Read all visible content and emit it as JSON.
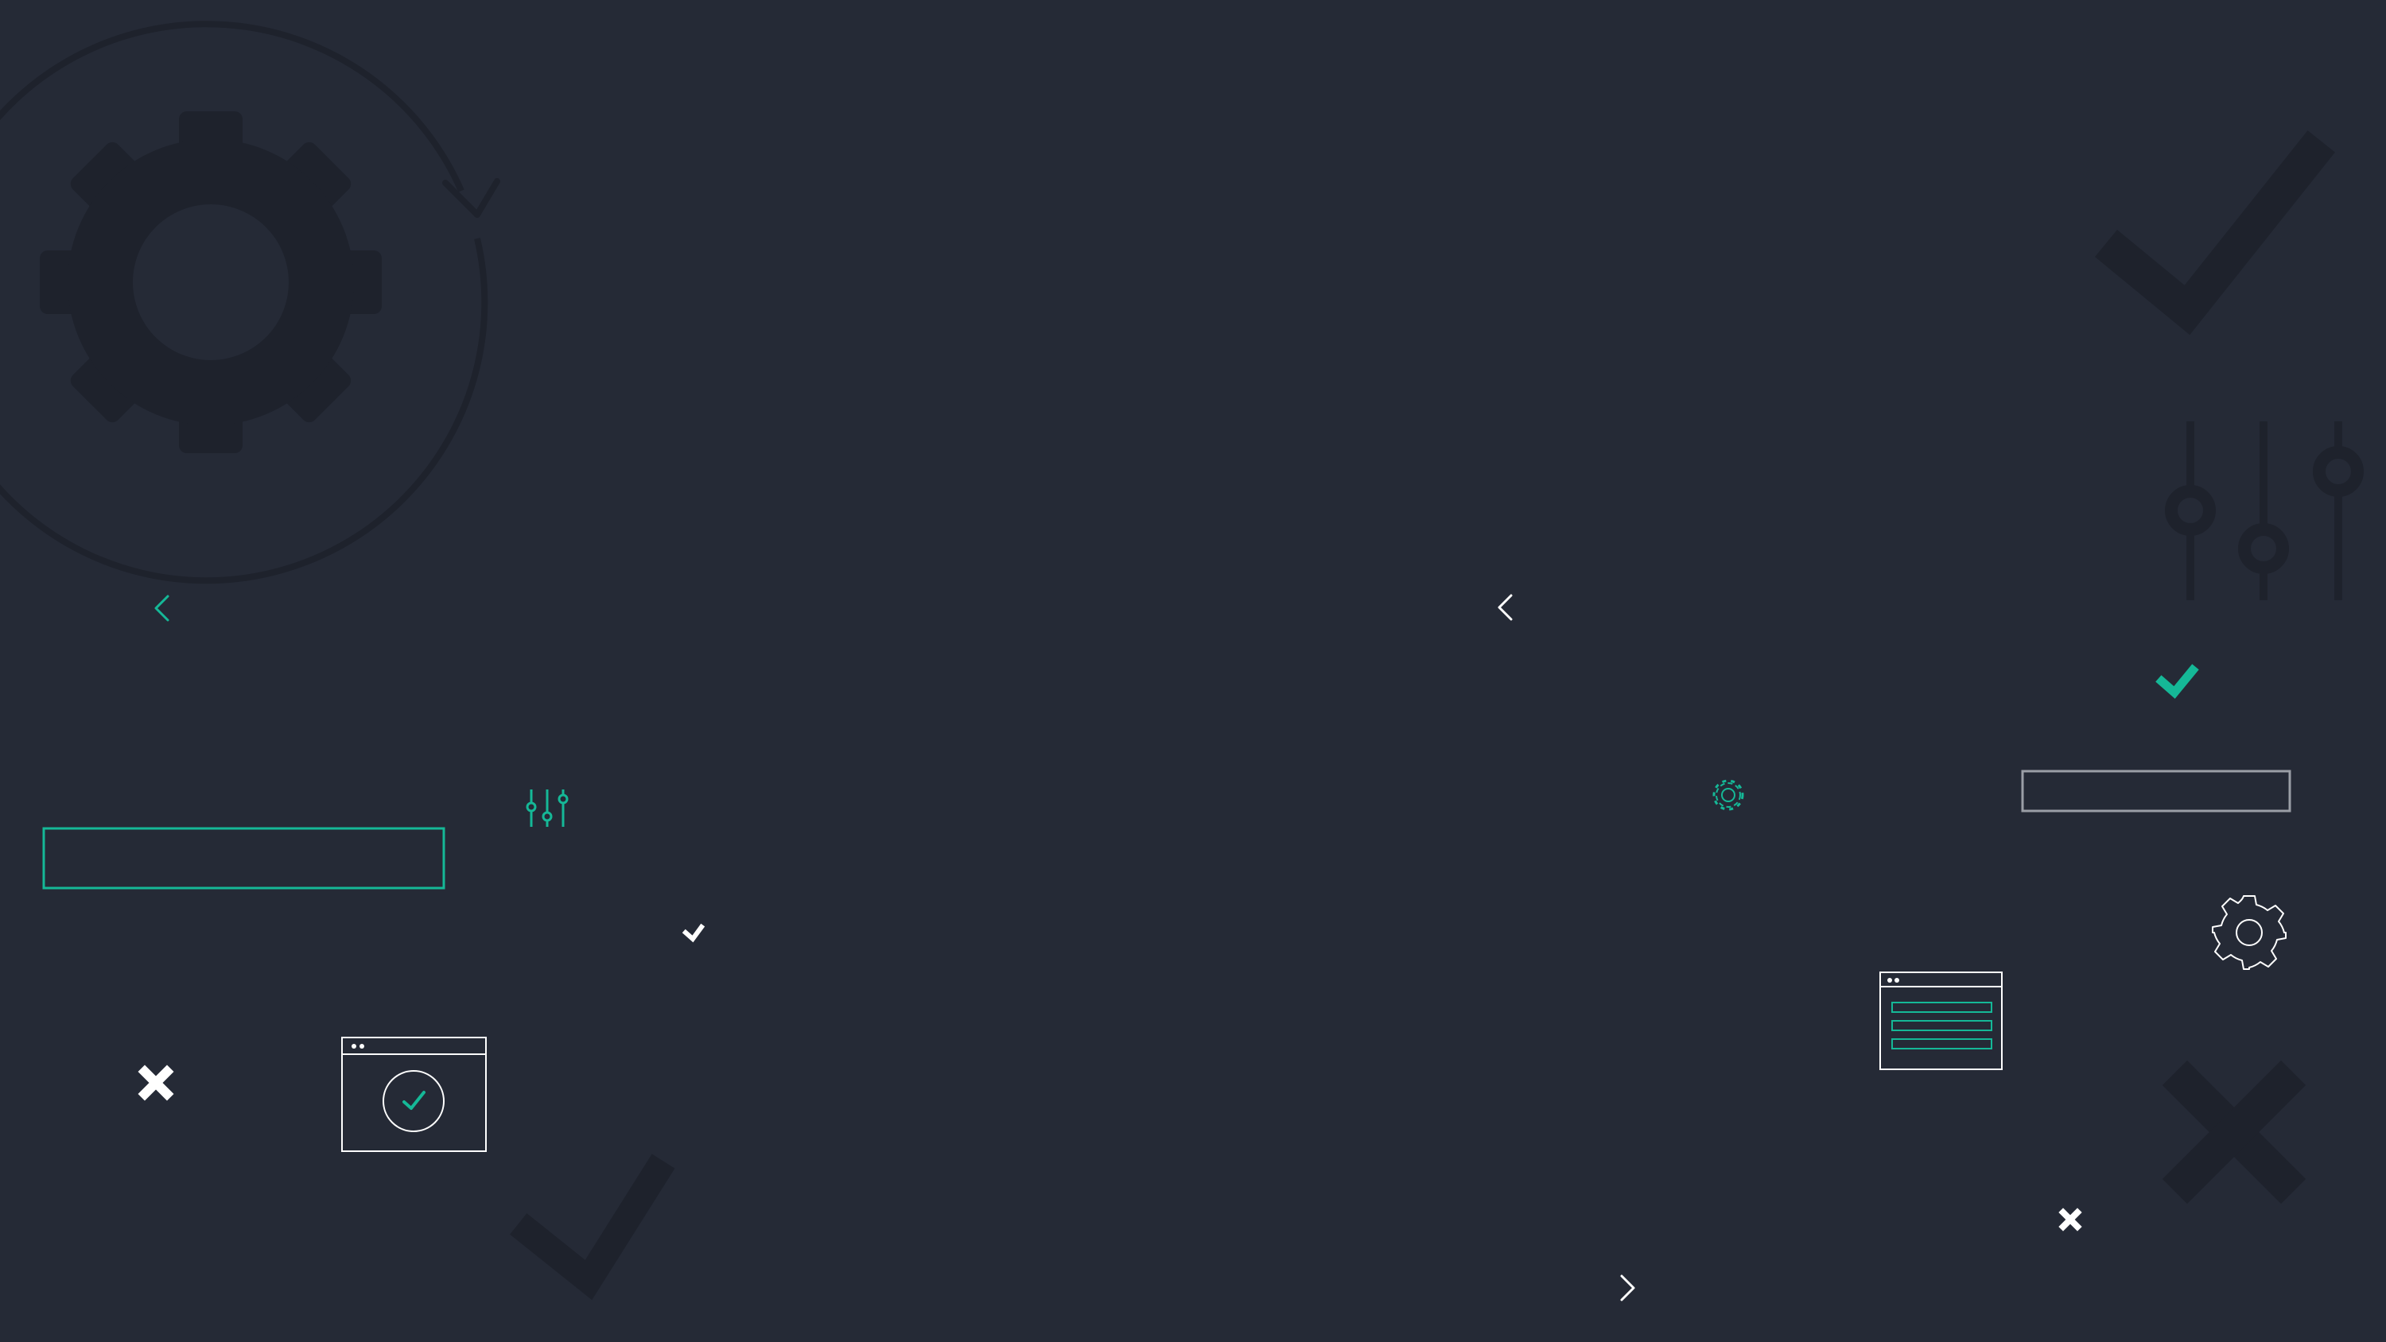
{
  "colors": {
    "background": "#252a36",
    "shadow": "#1e222c",
    "accent": "#15b897",
    "white": "#ffffff",
    "outline": "#9a9ea6"
  },
  "icons": [
    "gear-icon",
    "refresh-circle-icon",
    "check-icon",
    "sliders-icon",
    "chevron-left-icon",
    "chevron-right-icon",
    "close-icon",
    "browser-window-icon"
  ]
}
